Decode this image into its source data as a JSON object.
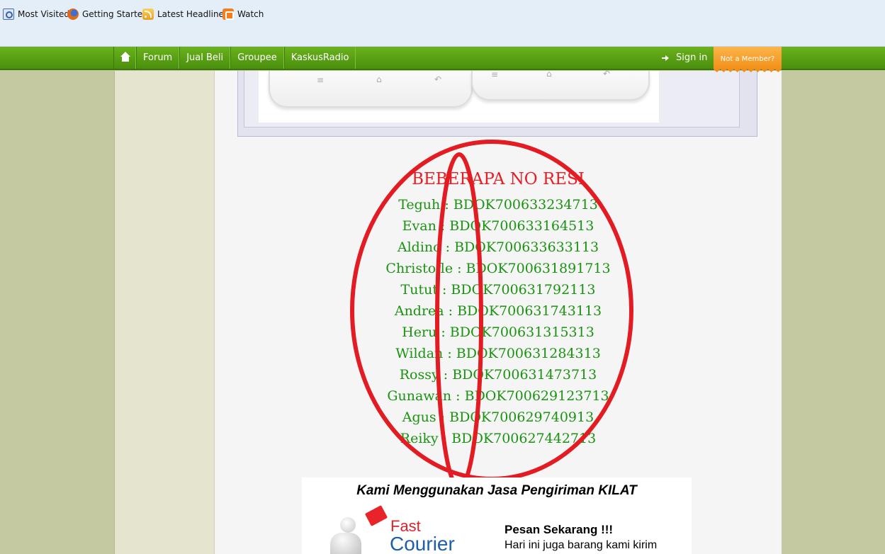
{
  "bookmarks": [
    {
      "label": "Most Visited",
      "icon": "most-visited-icon"
    },
    {
      "label": "Getting Started",
      "icon": "firefox-icon"
    },
    {
      "label": "Latest Headlines",
      "icon": "rss-icon"
    },
    {
      "label": "Watch",
      "icon": "blogger-icon"
    }
  ],
  "nav": {
    "items": [
      "Forum",
      "Jual Beli",
      "Groupee",
      "KaskusRadio"
    ],
    "signin_label": "Sign in",
    "member_label": "Not a Member?"
  },
  "resi": {
    "title": "BEBERAPA NO RESI",
    "lines": [
      "Teguh : BDOK700633234713",
      "Evan : BDOK700633164513",
      "Aldino : BDOK700633633113",
      "Christofle : BDOK700631891713",
      "Tutut : BDOK700631792113",
      "Andrea : BDOK700631743113",
      "Heru : BDOK700631315313",
      "Wildan : BDOK700631284313",
      "Rossy : BDOK700631473713",
      "Gunawan : BDOK700629123713",
      "Agus : BDOK700629740913",
      "Reiky : BDOK700627442713"
    ]
  },
  "banner": {
    "headline": "Kami Menggunakan Jasa Pengiriman KILAT",
    "logo_line1": "Fast",
    "logo_line2": "Courier",
    "cta_title": "Pesan Sekarang !!!",
    "cta_text": "Hari ini juga barang kami kirim"
  },
  "colors": {
    "nav_green": "#5aa316",
    "member_orange": "#f39a1f",
    "resi_title": "#e81e25",
    "resi_text": "#1a9311",
    "annotation_red": "#e31b23"
  }
}
